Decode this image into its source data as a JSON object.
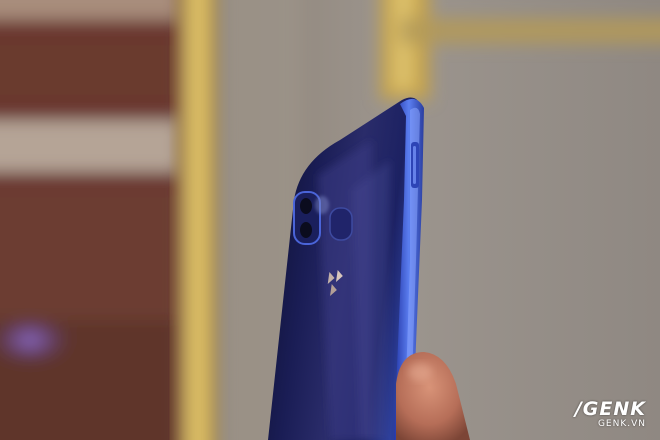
{
  "photo": {
    "subject": "phone-rear-closeup",
    "colors": {
      "wall_left": "#6e3a30",
      "wall_right": "#9a938c",
      "gold_frame": "#c9a44a",
      "phone_glass": "#171a4e",
      "phone_edge": "#3a5bd6",
      "skin": "#c8826a"
    }
  },
  "watermark": {
    "brand": "/GENK",
    "domain": "GENK.VN"
  }
}
